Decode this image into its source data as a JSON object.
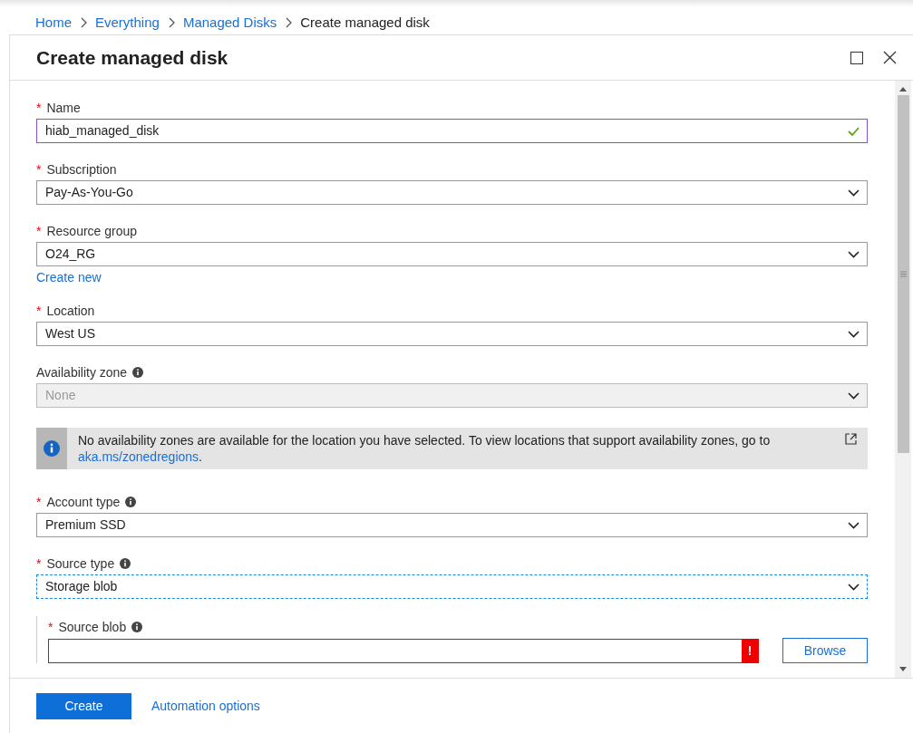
{
  "breadcrumb": [
    {
      "label": "Home",
      "current": false
    },
    {
      "label": "Everything",
      "current": false
    },
    {
      "label": "Managed Disks",
      "current": false
    },
    {
      "label": "Create managed disk",
      "current": true
    }
  ],
  "blade": {
    "title": "Create managed disk"
  },
  "fields": [
    {
      "kind": "text",
      "label": "Name",
      "required": "*",
      "value": "hiab_managed_disk",
      "valid": true
    },
    {
      "kind": "select",
      "label": "Subscription",
      "required": "*",
      "value": "Pay-As-You-Go"
    },
    {
      "kind": "select",
      "label": "Resource group",
      "required": "*",
      "value": "O24_RG",
      "link": "Create new"
    },
    {
      "kind": "select",
      "label": "Location",
      "required": "*",
      "value": "West US"
    },
    {
      "kind": "select",
      "label": "Availability zone",
      "info": true,
      "disabled": true,
      "value": "None"
    },
    {
      "kind": "notice",
      "text": "No availability zones are available for the location you have selected. To view locations that support availability zones, go to",
      "link": "aka.ms/zonedregions",
      "suffix": "."
    },
    {
      "kind": "select",
      "label": "Account type",
      "required": "*",
      "info": true,
      "value": "Premium SSD"
    },
    {
      "kind": "select",
      "label": "Source type",
      "required": "*",
      "info": true,
      "focused": true,
      "value": "Storage blob"
    },
    {
      "kind": "blob",
      "label": "Source blob",
      "required": "*",
      "info": true,
      "error": "!",
      "button": "Browse"
    }
  ],
  "footer": {
    "buttons": [
      {
        "kind": "primary",
        "label": "Create"
      },
      {
        "kind": "link",
        "label": "Automation options"
      }
    ]
  }
}
